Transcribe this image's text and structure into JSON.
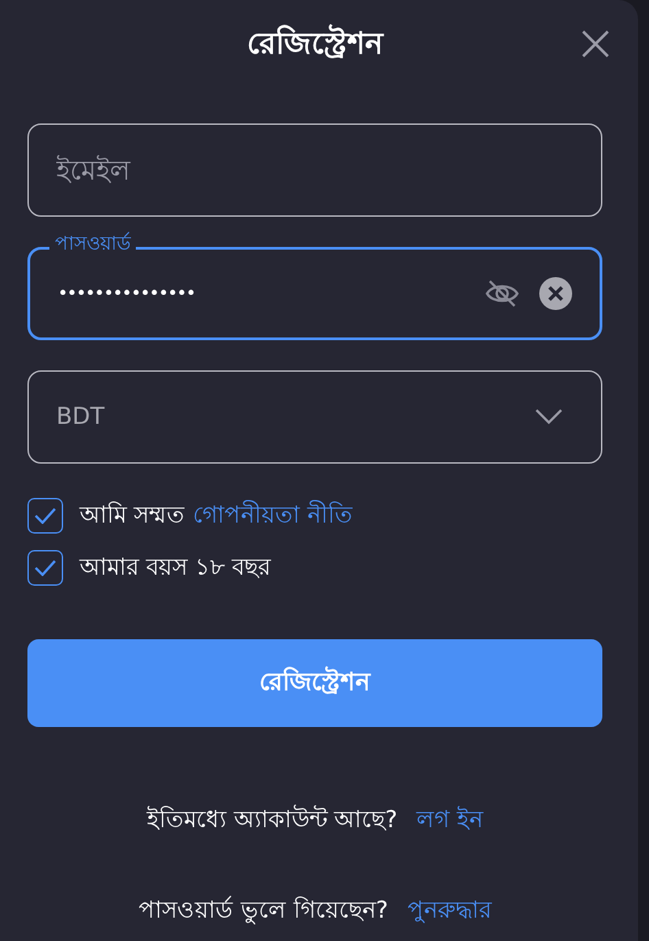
{
  "title": "রেজিস্ট্রেশন",
  "fields": [
    {
      "kind": "text",
      "placeholder": "ইমেইল"
    },
    {
      "kind": "password",
      "label": "পাসওয়ার্ড",
      "value": "•••••••••••••••",
      "focused": true
    },
    {
      "kind": "select",
      "value": "BDT"
    }
  ],
  "checks": [
    {
      "text": "আমি সম্মত",
      "link": "গোপনীয়তা নীতি",
      "checked": true
    },
    {
      "text": "আমার বয়স ১৮ বছর",
      "checked": true
    }
  ],
  "submit": "রেজিস্ট্রেশন",
  "footer": [
    {
      "text": "ইতিমধ্যে অ্যাকাউন্ট আছে?",
      "link": "লগ ইন"
    },
    {
      "text": "পাসওয়ার্ড ভুলে গিয়েছেন?",
      "link": "পুনরুদ্ধার"
    }
  ]
}
